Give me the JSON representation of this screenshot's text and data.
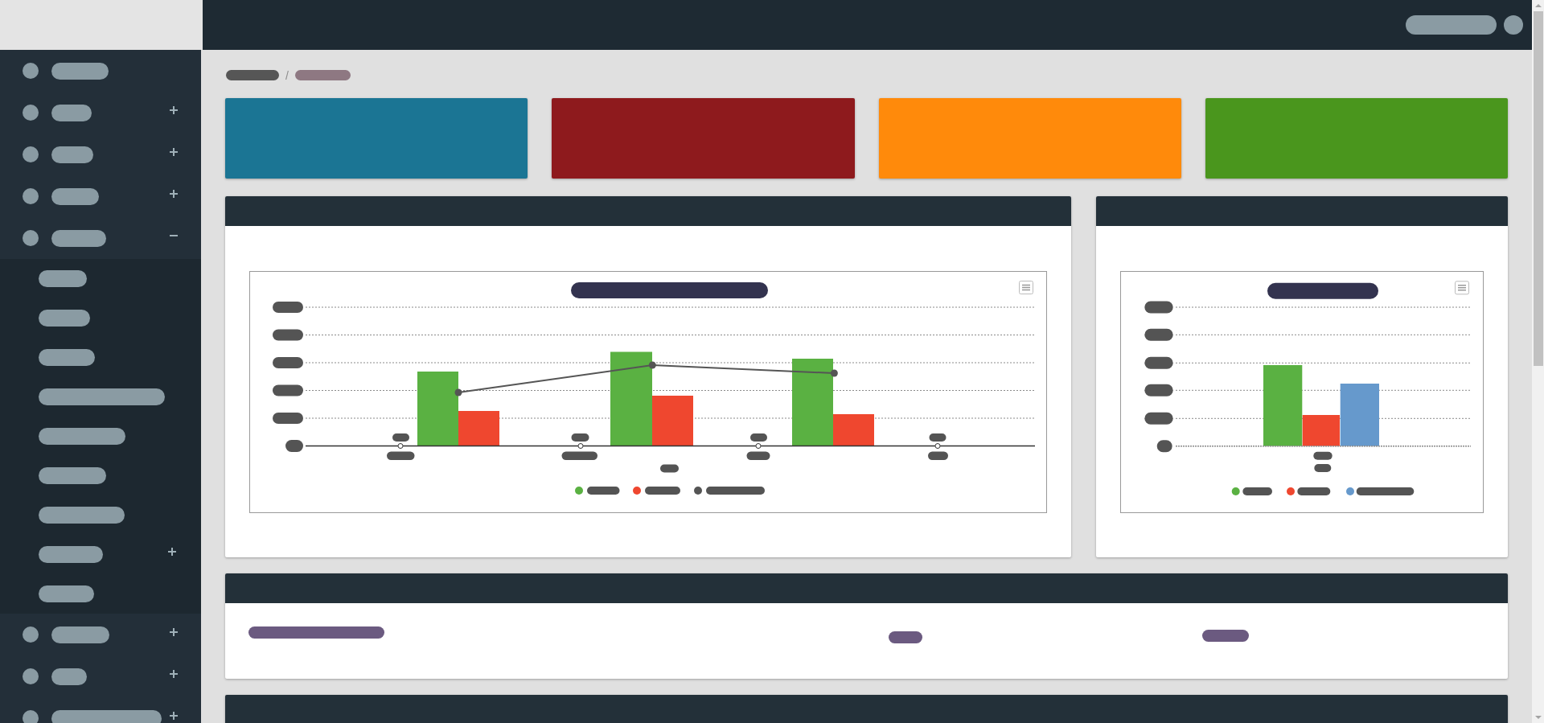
{
  "sidebar": {
    "items": [
      {
        "kind": "link"
      },
      {
        "kind": "group",
        "expanded": false
      },
      {
        "kind": "group",
        "expanded": false
      },
      {
        "kind": "group",
        "expanded": false
      },
      {
        "kind": "group",
        "expanded": true,
        "children": [
          {
            "kind": "link"
          },
          {
            "kind": "link"
          },
          {
            "kind": "link"
          },
          {
            "kind": "link"
          },
          {
            "kind": "link"
          },
          {
            "kind": "link"
          },
          {
            "kind": "link"
          },
          {
            "kind": "group",
            "expanded": false
          },
          {
            "kind": "link"
          }
        ]
      },
      {
        "kind": "group",
        "expanded": false
      },
      {
        "kind": "group",
        "expanded": false
      },
      {
        "kind": "group",
        "expanded": false
      }
    ]
  },
  "breadcrumb": {
    "items": [
      {
        "current": false
      },
      {
        "current": true
      }
    ],
    "separator": "/"
  },
  "stat_cards": [
    {
      "color": "#1b7594"
    },
    {
      "color": "#8e1a1d"
    },
    {
      "color": "#ff8a0b"
    },
    {
      "color": "#4a961d"
    }
  ],
  "charts": [
    {
      "legend": [
        {
          "color": "#5ab142"
        },
        {
          "color": "#ef472f"
        },
        {
          "color": "#555555"
        }
      ]
    },
    {
      "legend": [
        {
          "color": "#5ab142"
        },
        {
          "color": "#ef472f"
        },
        {
          "color": "#6699cc"
        }
      ]
    }
  ]
}
